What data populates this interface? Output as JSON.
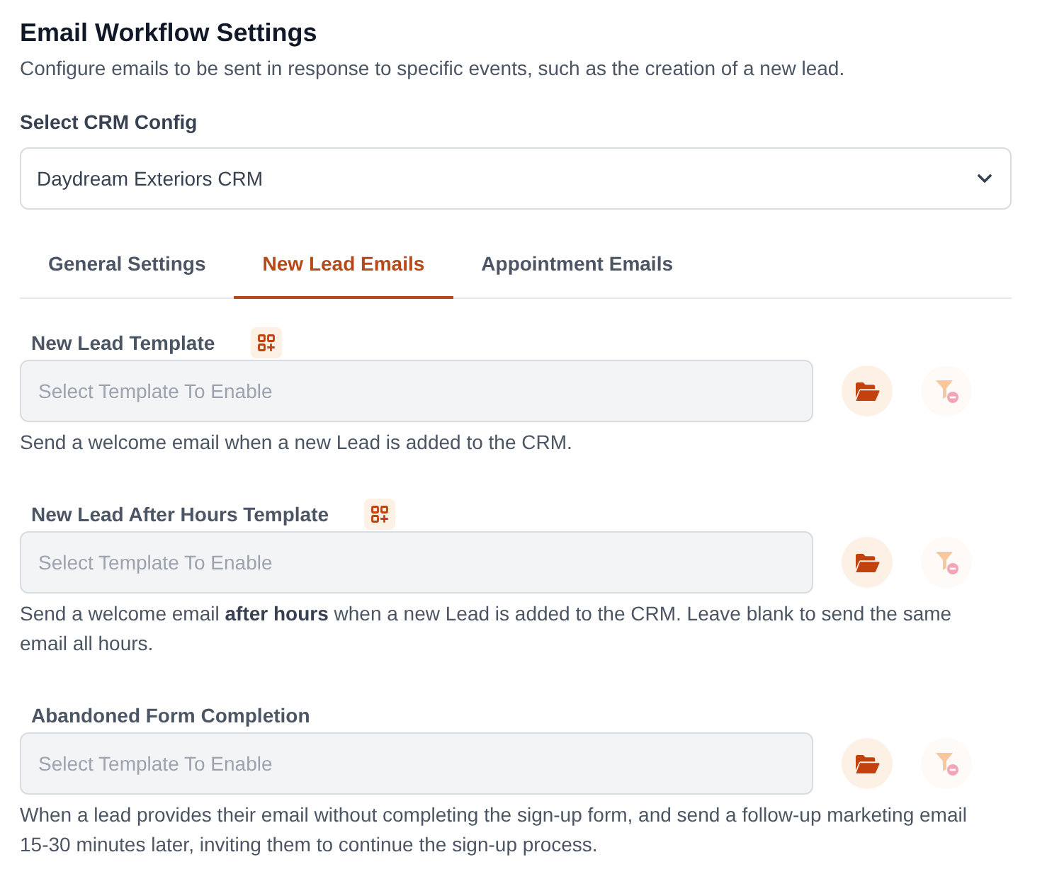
{
  "header": {
    "title": "Email Workflow Settings",
    "description": "Configure emails to be sent in response to specific events, such as the creation of a new lead."
  },
  "crm_config": {
    "label": "Select CRM Config",
    "value": "Daydream Exteriors CRM"
  },
  "tabs": [
    {
      "label": "General Settings",
      "selected": false
    },
    {
      "label": "New Lead Emails",
      "selected": true
    },
    {
      "label": "Appointment Emails",
      "selected": false
    }
  ],
  "templates": [
    {
      "label": "New Lead Template",
      "template_icon": true,
      "placeholder": "Select Template To Enable",
      "clear_disabled": true,
      "help": "Send a welcome email when a new Lead is added to the CRM."
    },
    {
      "label": "New Lead After Hours Template",
      "template_icon": true,
      "placeholder": "Select Template To Enable",
      "clear_disabled": true,
      "help": "Send a welcome email **after hours** when a new Lead is added to the CRM. Leave blank to send the same email all hours."
    },
    {
      "label": "Abandoned Form Completion",
      "template_icon": false,
      "placeholder": "Select Template To Enable",
      "clear_disabled": true,
      "help": "When a lead provides their email without completing the sign-up form, and send a follow-up marketing email 15-30 minutes later, inviting them to continue the sign-up process."
    }
  ]
}
